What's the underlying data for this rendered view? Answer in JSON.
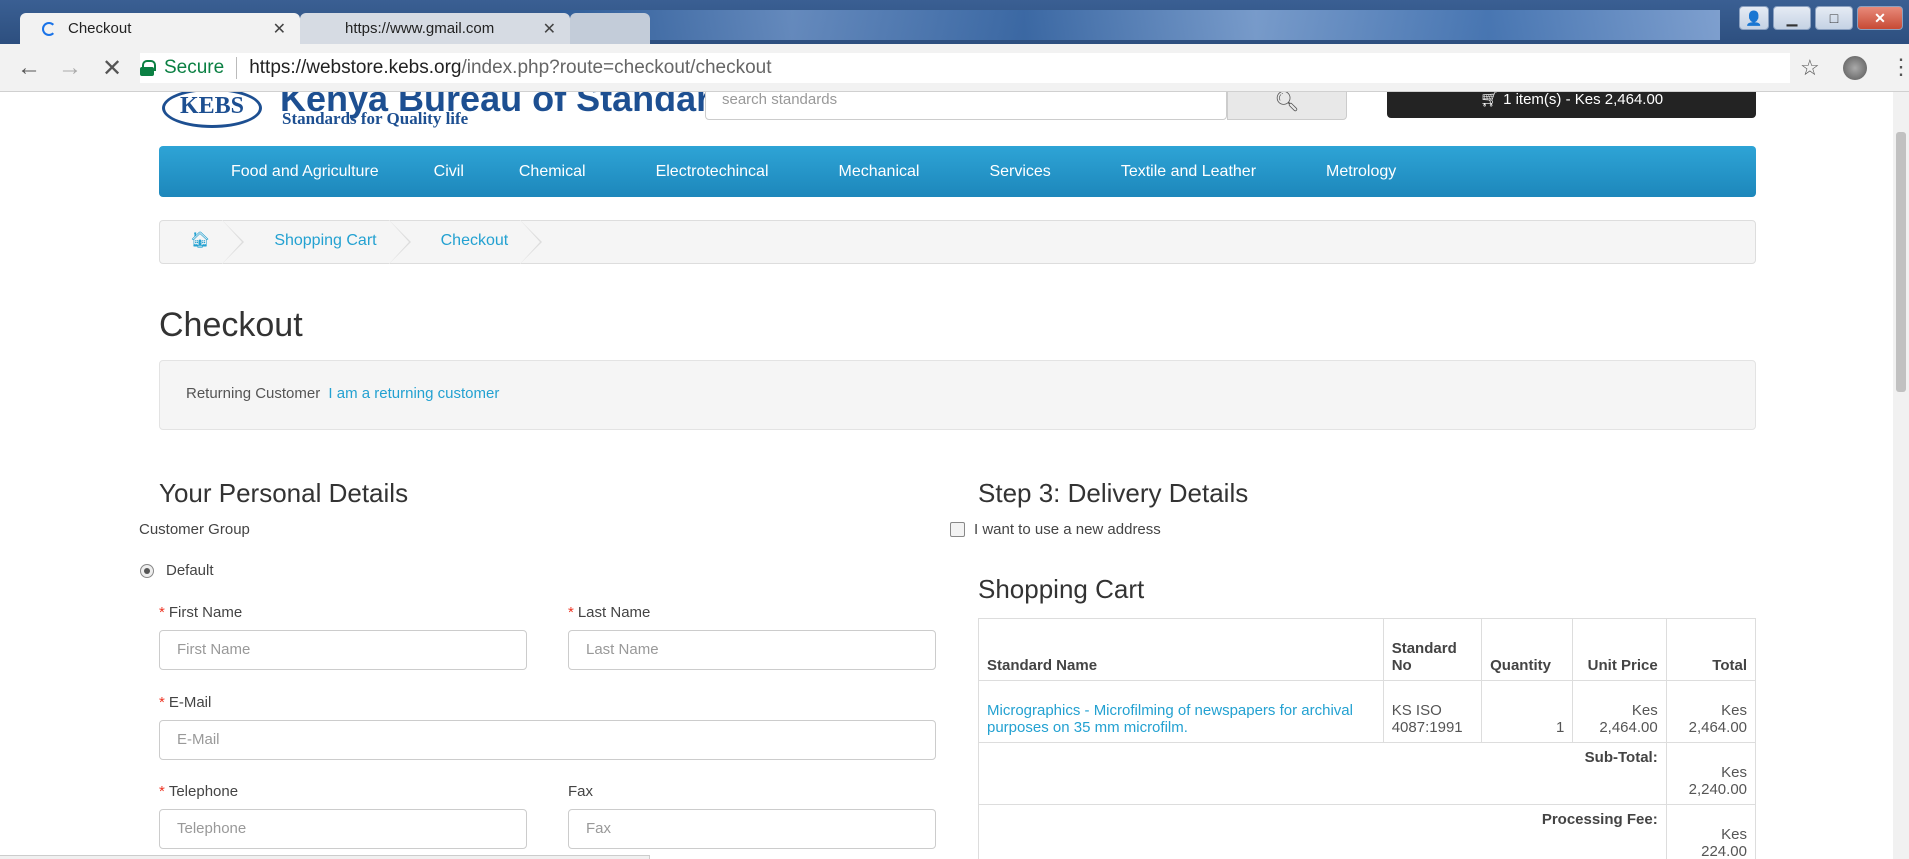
{
  "browser": {
    "tabs": [
      {
        "title": "Checkout",
        "active": true
      },
      {
        "title": "https://www.gmail.com",
        "active": false
      }
    ],
    "address": {
      "secure_label": "Secure",
      "url_host": "https://webstore.kebs.org",
      "url_path": "/index.php?route=checkout/checkout"
    },
    "icons": {
      "back": "back-arrow-icon",
      "forward": "forward-arrow-icon",
      "stop": "stop-icon",
      "star": "star-icon",
      "menu": "menu-icon"
    }
  },
  "header": {
    "logo_badge": "KEBS",
    "logo_title": "Kenya Bureau of Standards",
    "logo_subtitle": "Standards for Quality life",
    "search_placeholder": "search standards",
    "cart_label": "1 item(s) - Kes 2,464.00"
  },
  "menu": {
    "items": [
      "Food and Agriculture",
      "Civil",
      "Chemical",
      "Electrotechincal",
      "Mechanical",
      "Services",
      "Textile and Leather",
      "Metrology"
    ],
    "accent_color": "#1d87bb"
  },
  "breadcrumb": {
    "items": [
      "Shopping Cart",
      "Checkout"
    ]
  },
  "checkout": {
    "title": "Checkout",
    "returning_text": "Returning Customer",
    "returning_link": "I am a returning customer"
  },
  "personal": {
    "title": "Your Personal Details",
    "customer_group_label": "Customer Group",
    "group_option": "Default",
    "first_name_label": "First Name",
    "first_name_placeholder": "First Name",
    "last_name_label": "Last Name",
    "last_name_placeholder": "Last Name",
    "email_label": "E-Mail",
    "email_placeholder": "E-Mail",
    "telephone_label": "Telephone",
    "telephone_placeholder": "Telephone",
    "fax_label": "Fax",
    "fax_placeholder": "Fax"
  },
  "delivery": {
    "title": "Step 3: Delivery Details",
    "new_address_label": "I want to use a new address"
  },
  "cart": {
    "title": "Shopping Cart",
    "headers": {
      "name": "Standard Name",
      "no": "Standard No",
      "quantity": "Quantity",
      "unit_price": "Unit Price",
      "total": "Total"
    },
    "rows": [
      {
        "name": "Micrographics - Microfilming of newspapers for archival purposes on 35 mm microfilm.",
        "no": "KS ISO 4087:1991",
        "quantity": "1",
        "unit_price": "Kes 2,464.00",
        "total": "Kes 2,464.00"
      }
    ],
    "subtotal_label": "Sub-Total:",
    "subtotal_value": "Kes 2,240.00",
    "fee_label": "Processing Fee:",
    "fee_value": "Kes 224.00"
  }
}
